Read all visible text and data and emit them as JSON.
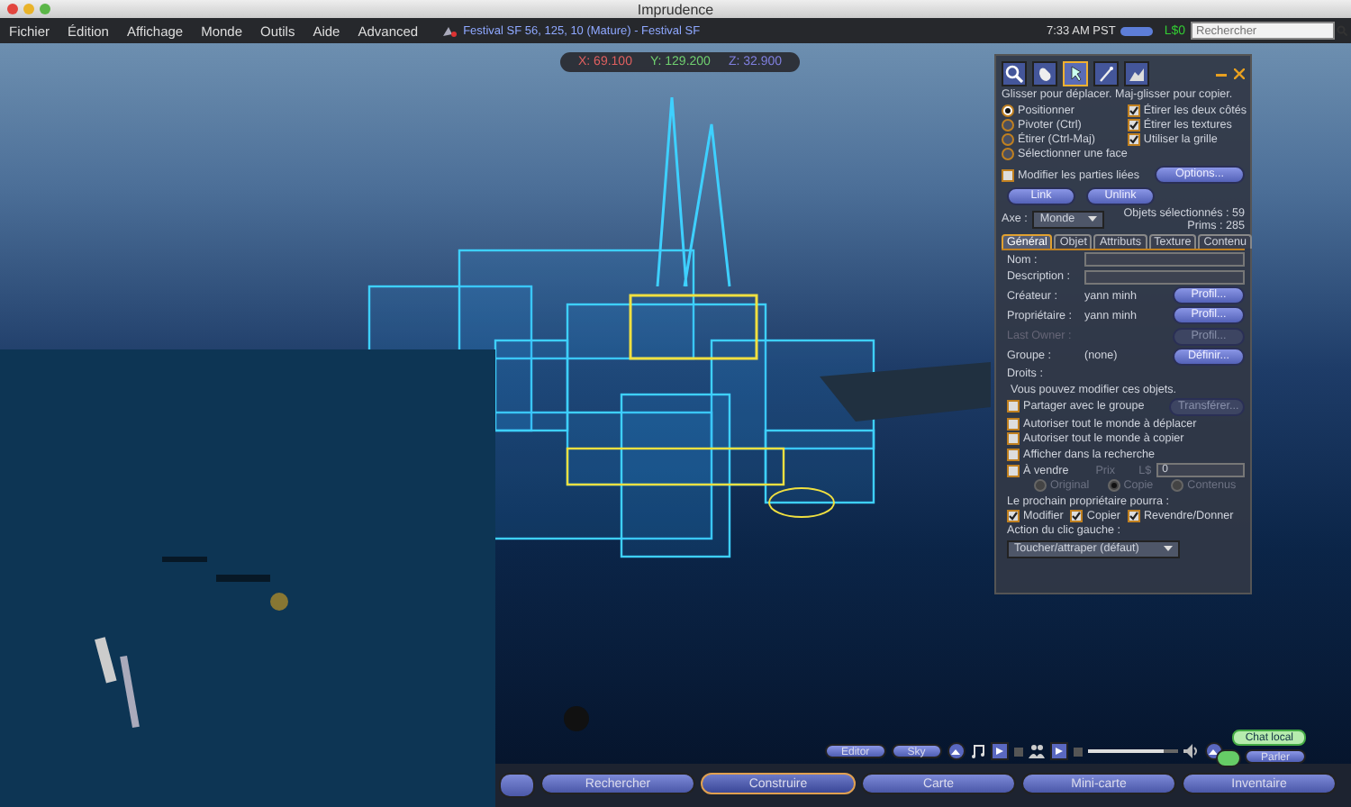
{
  "window": {
    "title": "Imprudence"
  },
  "menu": [
    "Fichier",
    "Édition",
    "Affichage",
    "Monde",
    "Outils",
    "Aide",
    "Advanced"
  ],
  "location": "Festival SF 56, 125, 10 (Mature) - Festival SF",
  "clock": "7:33 AM PST",
  "balance": "L$0",
  "search": {
    "placeholder": "Rechercher"
  },
  "coordinates": [
    {
      "text": "X: 69.100",
      "color": "#e06060"
    },
    {
      "text": "Y: 129.200",
      "color": "#70d070"
    },
    {
      "text": "Z: 32.900",
      "color": "#8080e0"
    }
  ],
  "build_panel": {
    "tools": [
      {
        "kind": "focus",
        "selected": false
      },
      {
        "kind": "move",
        "selected": false
      },
      {
        "kind": "edit",
        "selected": true
      },
      {
        "kind": "create",
        "selected": false
      },
      {
        "kind": "land",
        "selected": false
      }
    ],
    "hint": "Glisser pour déplacer. Maj-glisser pour copier.",
    "modes": [
      {
        "label": "Positionner",
        "selected": true
      },
      {
        "label": "Pivoter (Ctrl)",
        "selected": false
      },
      {
        "label": "Étirer (Ctrl-Maj)",
        "selected": false
      },
      {
        "label": "Sélectionner une face",
        "selected": false
      }
    ],
    "stretch_options": [
      {
        "label": "Étirer les deux côtés",
        "checked": true
      },
      {
        "label": "Étirer les textures",
        "checked": true
      },
      {
        "label": "Utiliser la grille",
        "checked": true
      }
    ],
    "linked_parts": {
      "label": "Modifier les parties liées",
      "checked": false
    },
    "options_button": "Options...",
    "link_buttons": [
      "Link",
      "Unlink"
    ],
    "axis": {
      "label": "Axe :",
      "value": "Monde"
    },
    "selected_count": "Objets sélectionnés : 59",
    "prims": "Prims : 285",
    "tabs": [
      {
        "label": "Général",
        "selected": true
      },
      {
        "label": "Objet",
        "selected": false
      },
      {
        "label": "Attributs",
        "selected": false
      },
      {
        "label": "Texture",
        "selected": false
      },
      {
        "label": "Contenu",
        "selected": false
      }
    ],
    "fields": [
      {
        "label": "Nom :"
      },
      {
        "label": "Description :"
      }
    ],
    "people": [
      {
        "label": "Créateur :",
        "value": "yann minh",
        "button": "Profil...",
        "disabled": false
      },
      {
        "label": "Propriétaire :",
        "value": "yann minh",
        "button": "Profil...",
        "disabled": false
      },
      {
        "label": "Last Owner :",
        "button": "Profil...",
        "disabled": true
      },
      {
        "label": "Groupe :",
        "value": "(none)",
        "button": "Définir...",
        "disabled": false
      }
    ],
    "rights_title": "Droits :",
    "rights_note": "Vous pouvez modifier ces objets.",
    "permissions": [
      {
        "label": "Partager avec le groupe",
        "checked": false,
        "button": "Transférer..."
      },
      {
        "label": "Autoriser tout le monde à déplacer",
        "checked": false
      },
      {
        "label": "Autoriser tout le monde à copier",
        "checked": false
      },
      {
        "label": "Afficher dans la recherche",
        "checked": false
      }
    ],
    "for_sale": {
      "label": "À vendre",
      "checked": false,
      "price_label": "Prix",
      "currency": "L$",
      "price": "0"
    },
    "sale_types": [
      {
        "label": "Original",
        "selected": false
      },
      {
        "label": "Copie",
        "selected": true
      },
      {
        "label": "Contenus",
        "selected": false
      }
    ],
    "next_owner_title": "Le prochain propriétaire pourra :",
    "next_owner": [
      {
        "label": "Modifier",
        "checked": true
      },
      {
        "label": "Copier",
        "checked": true
      },
      {
        "label": "Revendre/Donner",
        "checked": true
      }
    ],
    "click_action": {
      "label": "Action du clic gauche :",
      "value": "Toucher/attraper (défaut)"
    }
  },
  "media_bar": {
    "editor": "Editor",
    "sky": "Sky",
    "volume": {
      "level": 0.85
    }
  },
  "chat": {
    "chat_button": "Chat local",
    "talk_button": "Parler"
  },
  "toolbar": [
    {
      "label": "Rechercher",
      "selected": false
    },
    {
      "label": "Construire",
      "selected": true
    },
    {
      "label": "Carte",
      "selected": false
    },
    {
      "label": "Mini-carte",
      "selected": false
    },
    {
      "label": "Inventaire",
      "selected": false
    }
  ]
}
